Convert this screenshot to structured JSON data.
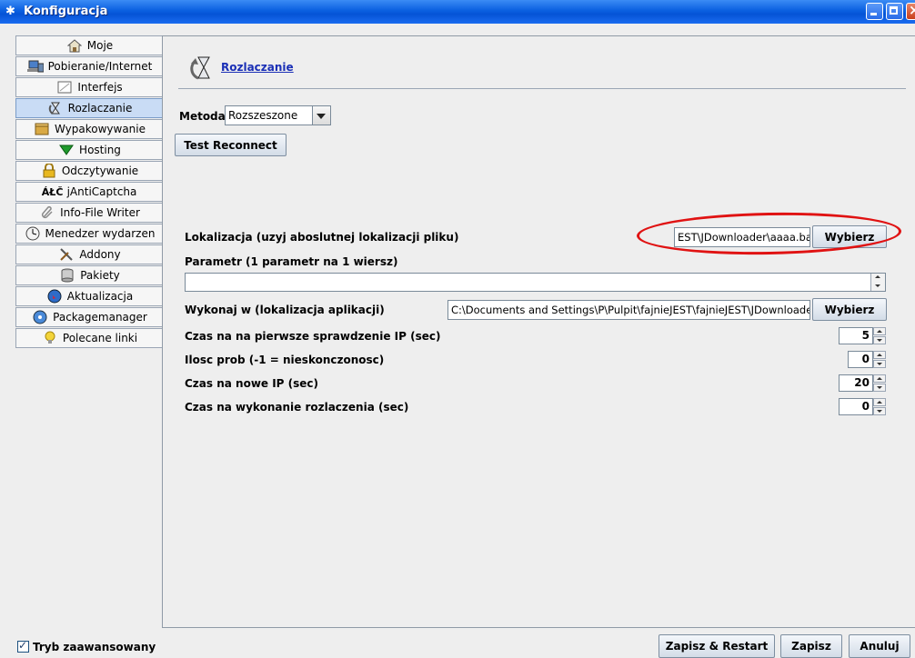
{
  "window": {
    "title": "Konfiguracja",
    "icon": "gear-star-icon"
  },
  "sidebar": {
    "items": [
      {
        "label": "Moje",
        "icon": "home-icon"
      },
      {
        "label": "Pobieranie/Internet",
        "icon": "network-computer-icon"
      },
      {
        "label": "Interfejs",
        "icon": "window-icon"
      },
      {
        "label": "Rozlaczanie",
        "icon": "hourglass-icon",
        "selected": true
      },
      {
        "label": "Wypakowywanie",
        "icon": "box-icon"
      },
      {
        "label": "Hosting",
        "icon": "green-arrow-down-icon"
      },
      {
        "label": "Odczytywanie",
        "icon": "lock-icon"
      },
      {
        "label": "jAntiCaptcha",
        "icon": "text-abc-icon",
        "icon_text": "ÁŁČ"
      },
      {
        "label": "Info-File Writer",
        "icon": "paperclip-icon"
      },
      {
        "label": "Menedzer wydarzen",
        "icon": "clock-icon"
      },
      {
        "label": "Addony",
        "icon": "tools-icon"
      },
      {
        "label": "Pakiety",
        "icon": "database-icon"
      },
      {
        "label": "Aktualizacja",
        "icon": "globe-icon"
      },
      {
        "label": "Packagemanager",
        "icon": "disc-icon"
      },
      {
        "label": "Polecane linki",
        "icon": "lightbulb-icon"
      }
    ]
  },
  "main": {
    "header_link": "Rozlaczanie",
    "header_icon": "hourglass-reload-icon",
    "metoda_label": "Metoda:",
    "metoda_value": "Rozszeszone",
    "test_button": "Test Reconnect",
    "lokalizacja_label": "Lokalizacja (uzyj aboslutnej lokalizacji pliku)",
    "lokalizacja_value": "EST\\JDownloader\\aaaa.bat",
    "wybierz_label": "Wybierz",
    "parametr_label": "Parametr (1 parametr na 1 wiersz)",
    "parametr_value": "",
    "wykonaj_label": "Wykonaj w (lokalizacja aplikacji)",
    "wykonaj_value": "C:\\Documents and Settings\\P\\Pulpit\\fajnieJEST\\fajnieJEST\\JDownloader",
    "spinners": [
      {
        "label": "Czas na na pierwsze sprawdzenie IP (sec)",
        "value": "5"
      },
      {
        "label": "Ilosc prob (-1 = nieskonczonosc)",
        "value": "0"
      },
      {
        "label": "Czas na nowe IP (sec)",
        "value": "20"
      },
      {
        "label": "Czas na wykonanie rozlaczenia (sec)",
        "value": "0"
      }
    ]
  },
  "footer": {
    "advanced_label": "Tryb zaawansowany",
    "advanced_checked": true,
    "save_restart": "Zapisz & Restart",
    "save": "Zapisz",
    "cancel": "Anuluj"
  },
  "colors": {
    "titlebar": "#0553d6",
    "selected_nav": "#c9dcf5",
    "link": "#1a2fb6",
    "annotation": "#e01212"
  }
}
